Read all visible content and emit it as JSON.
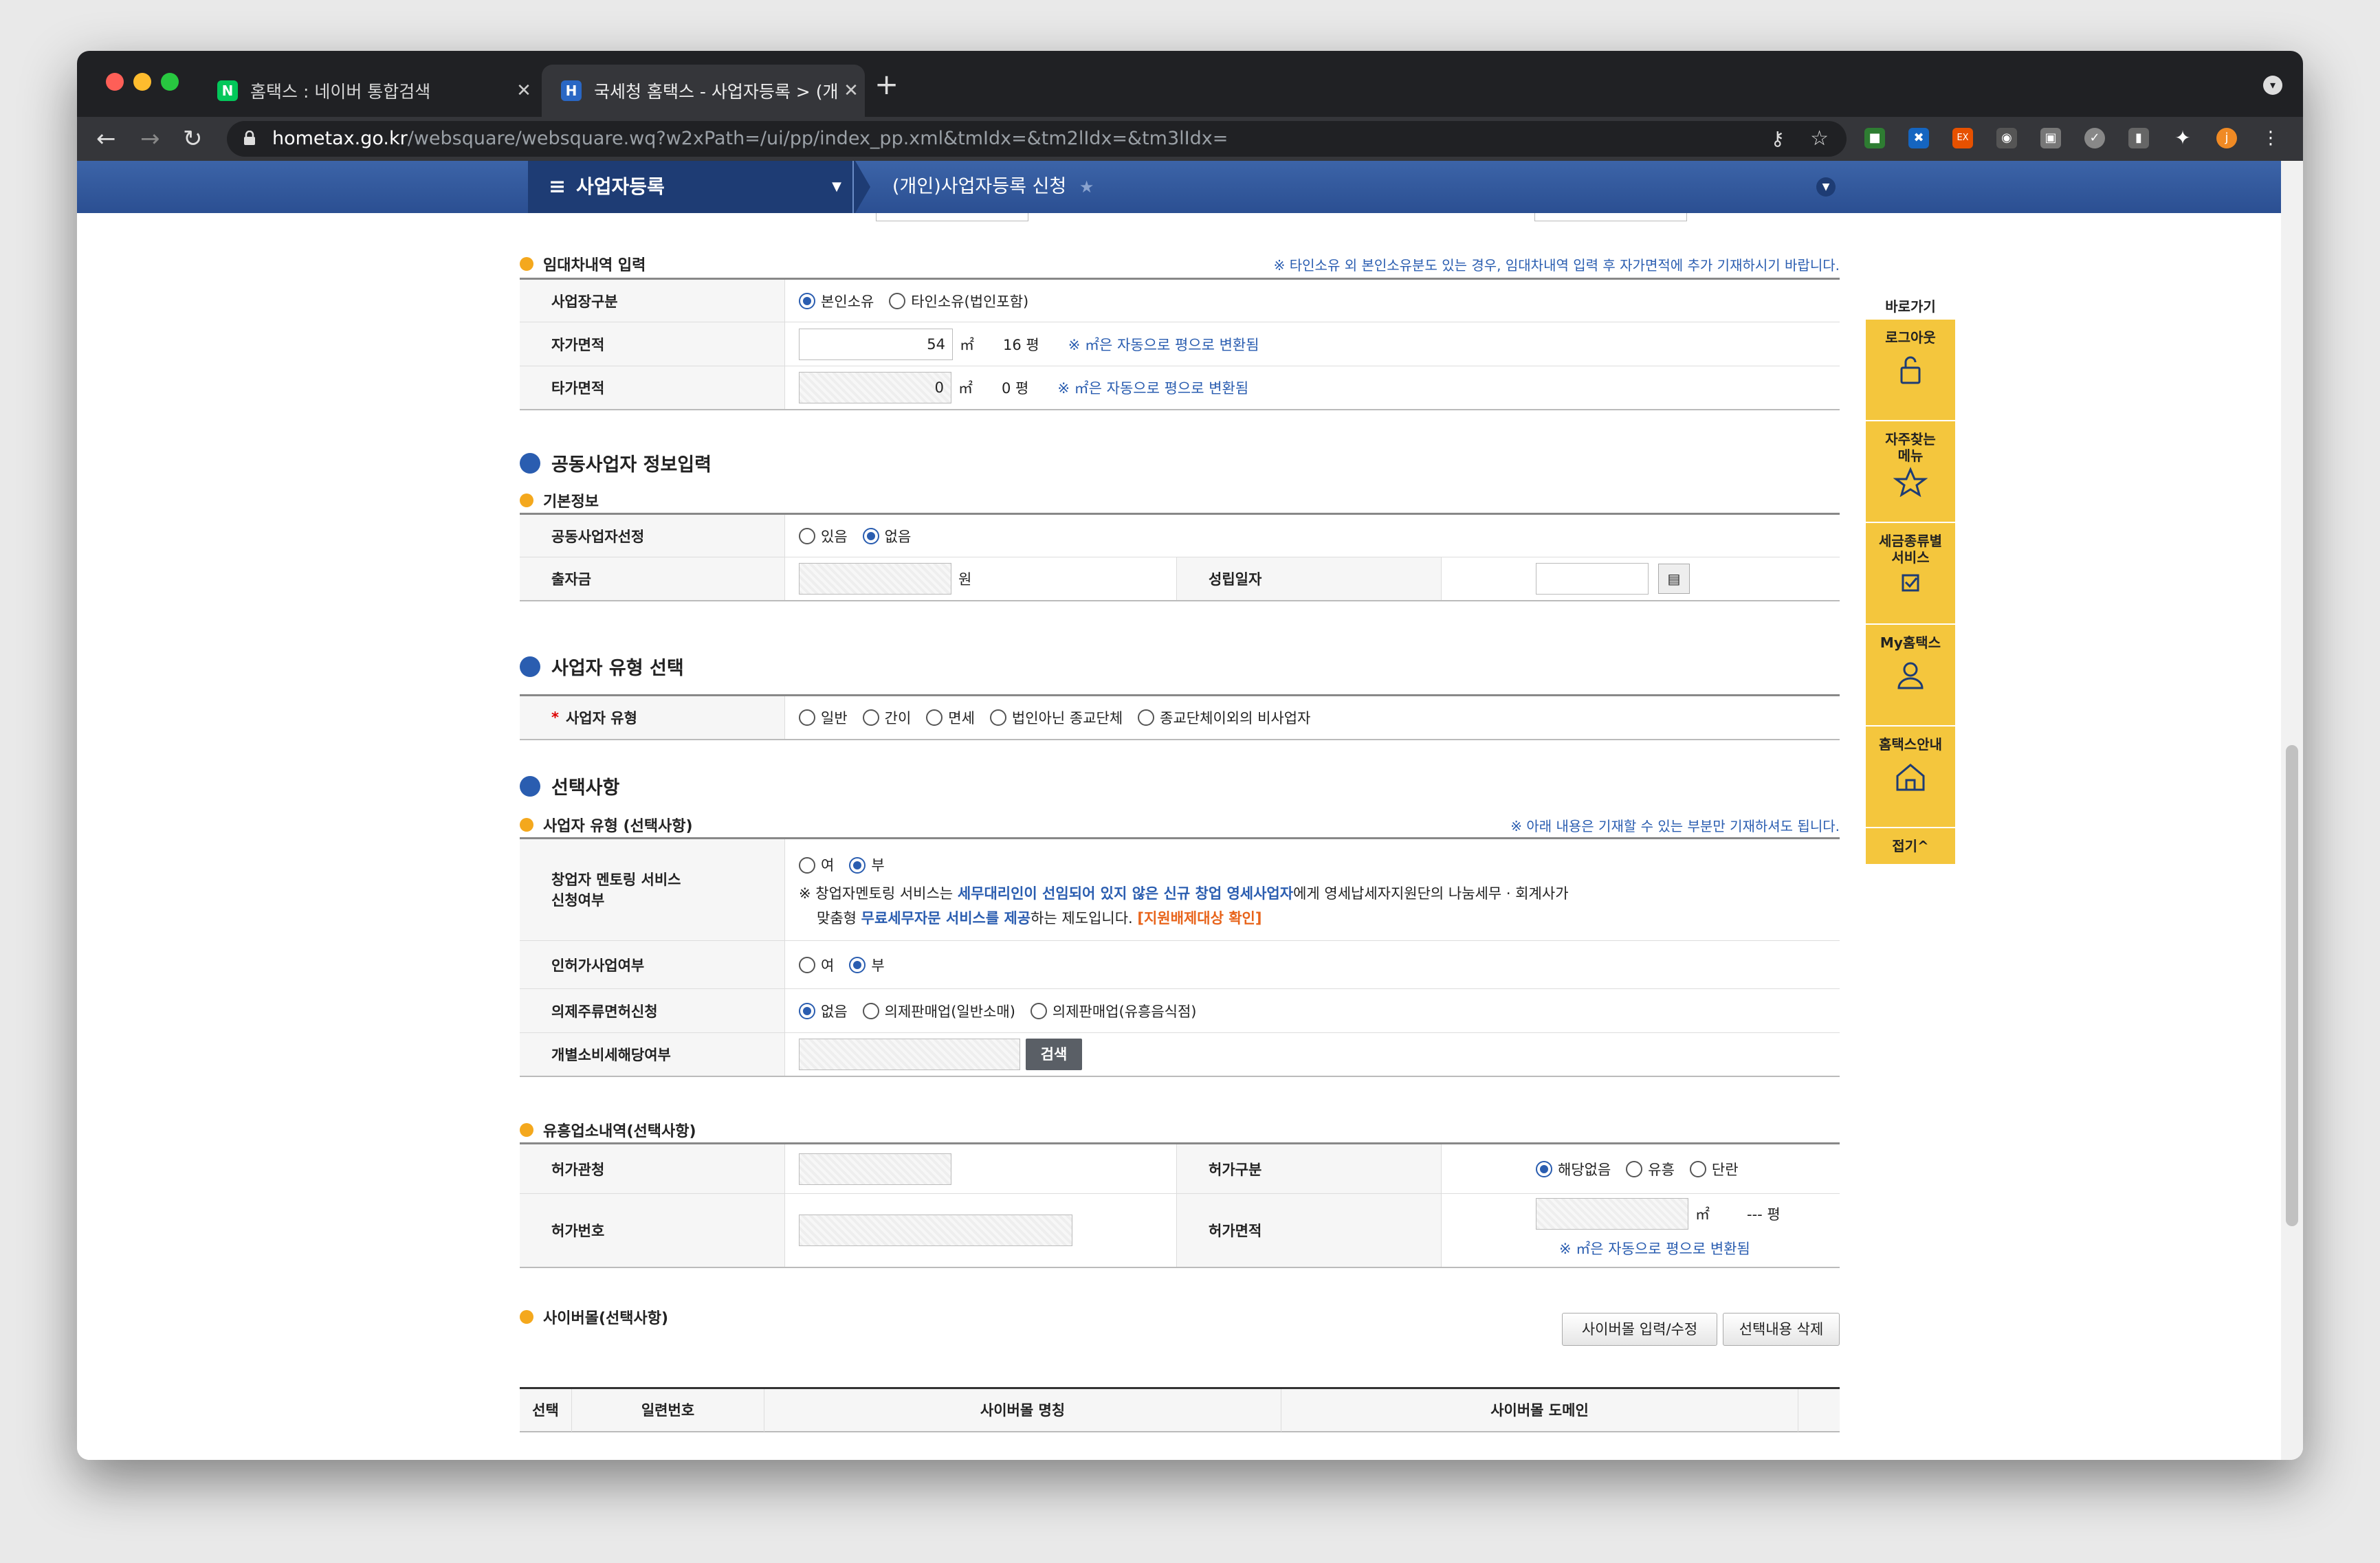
{
  "browser": {
    "tabs": [
      {
        "title": "홈택스 : 네이버 통합검색",
        "favicon": "N"
      },
      {
        "title": "국세청 홈택스 - 사업자등록 > (개인)",
        "favicon": "H"
      }
    ],
    "url_host": "hometax.go.kr",
    "url_path": "/websquare/websquare.wq?w2xPath=/ui/pp/index_pp.xml&tmIdx=&tm2lIdx=&tm3lIdx=",
    "profile_initial": "j"
  },
  "site_nav": {
    "menu": "사업자등록",
    "current": "(개인)사업자등록 신청"
  },
  "lease": {
    "title": "임대차내역 입력",
    "note": "※ 타인소유 외 본인소유분도 있는 경우, 임대차내역 입력 후 자가면적에 추가 기재하시기 바랍니다.",
    "place_label": "사업장구분",
    "place_opts": [
      "본인소유",
      "타인소유(법인포함)"
    ],
    "own_label": "자가면적",
    "own_value": "54",
    "own_pyeong": "16 평",
    "other_label": "타가면적",
    "other_value": "0",
    "other_pyeong": "0 평",
    "unit": "㎡",
    "convert_note": "※ ㎡은 자동으로 평으로 변환됨"
  },
  "joint": {
    "section": "공동사업자 정보입력",
    "sub": "기본정보",
    "select_label": "공동사업자선정",
    "select_opts": [
      "있음",
      "없음"
    ],
    "capital_label": "출자금",
    "capital_unit": "원",
    "date_label": "성립일자"
  },
  "biztype": {
    "section": "사업자 유형 선택",
    "label": "사업자 유형",
    "required_mark": "*",
    "opts": [
      "일반",
      "간이",
      "면세",
      "법인아닌 종교단체",
      "종교단체이외의 비사업자"
    ]
  },
  "optional": {
    "section": "선택사항",
    "sub": "사업자 유형 (선택사항)",
    "note": "※ 아래 내용은 기재할 수 있는 부분만 기재하셔도 됩니다.",
    "mentor_label1": "창업자 멘토링 서비스",
    "mentor_label2": "신청여부",
    "yes": "여",
    "no": "부",
    "mentor_desc_1a": "※ 창업자멘토링 서비스는 ",
    "mentor_desc_1b": "세무대리인이 선임되어 있지 않은 신규 창업 영세사업자",
    "mentor_desc_1c": "에게 영세납세자지원단의 나눔세무 · 회계사가",
    "mentor_desc_2a": "맞춤형 ",
    "mentor_desc_2b": "무료세무자문 서비스를 제공",
    "mentor_desc_2c": "하는 제도입니다. ",
    "mentor_link": "[지원배제대상 확인]",
    "permit_label": "인허가사업여부",
    "liquor_label": "의제주류면허신청",
    "liquor_opts": [
      "없음",
      "의제판매업(일반소매)",
      "의제판매업(유흥음식점)"
    ],
    "excise_label": "개별소비세해당여부",
    "search_btn": "검색"
  },
  "entertainment": {
    "sub": "유흥업소내역(선택사항)",
    "office_label": "허가관청",
    "type_label": "허가구분",
    "type_opts": [
      "해당없음",
      "유흥",
      "단란"
    ],
    "number_label": "허가번호",
    "area_label": "허가면적",
    "area_unit": "㎡",
    "area_pyeong": "--- 평",
    "convert_note": "※ ㎡은 자동으로 평으로 변환됨"
  },
  "cyber": {
    "sub": "사이버몰(선택사항)",
    "edit_btn": "사이버몰 입력/수정",
    "delete_btn": "선택내용 삭제",
    "cols": [
      "선택",
      "일련번호",
      "사이버몰 명칭",
      "사이버몰 도메인"
    ]
  },
  "quick": {
    "title": "바로가기",
    "items": [
      "로그아웃",
      "자주찾는\n메뉴",
      "세금종류별\n서비스",
      "My홈택스",
      "홈택스안내"
    ],
    "fold": "접기^"
  }
}
